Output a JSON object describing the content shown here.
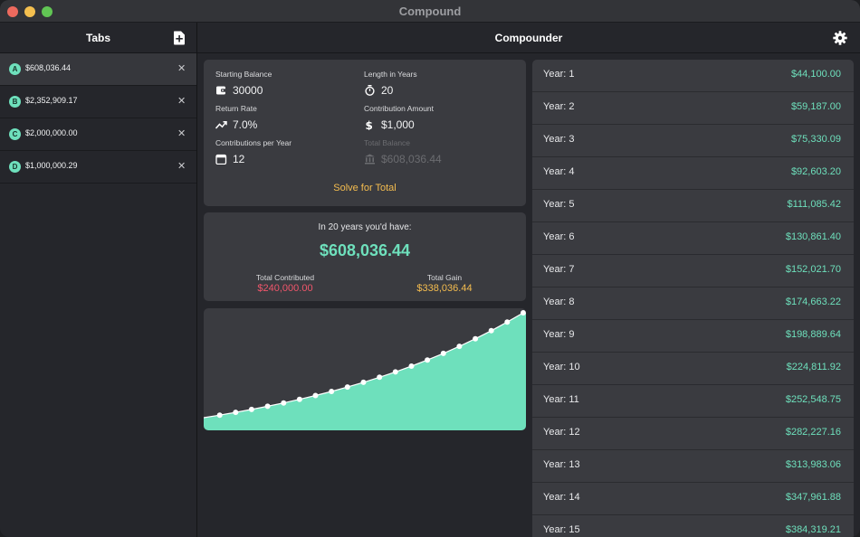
{
  "app": {
    "title": "Compound"
  },
  "sidebar": {
    "title": "Tabs",
    "tabs": [
      {
        "badge": "A",
        "label": "$608,036.44",
        "active": true
      },
      {
        "badge": "B",
        "label": "$2,352,909.17",
        "active": false
      },
      {
        "badge": "C",
        "label": "$2,000,000.00",
        "active": false
      },
      {
        "badge": "D",
        "label": "$1,000,000.29",
        "active": false
      }
    ],
    "close_glyph": "✕"
  },
  "main": {
    "title": "Compounder"
  },
  "inputs": {
    "starting_balance": {
      "label": "Starting Balance",
      "value": "30000",
      "icon": "wallet-icon"
    },
    "length_in_years": {
      "label": "Length in Years",
      "value": "20",
      "icon": "stopwatch-icon"
    },
    "return_rate": {
      "label": "Return Rate",
      "value": "7.0%",
      "icon": "trend-icon"
    },
    "contribution_amount": {
      "label": "Contribution Amount",
      "value": "$1,000",
      "icon": "dollar-icon"
    },
    "contributions_per_year": {
      "label": "Contributions per Year",
      "value": "12",
      "icon": "calendar-icon"
    },
    "total_balance": {
      "label": "Total Balance",
      "value": "$608,036.44",
      "icon": "bank-icon"
    },
    "solve_label": "Solve for Total"
  },
  "result": {
    "caption": "In 20 years you'd have:",
    "total": "$608,036.44",
    "contributed_label": "Total Contributed",
    "contributed_value": "$240,000.00",
    "gain_label": "Total Gain",
    "gain_value": "$338,036.44"
  },
  "colors": {
    "accent_green": "#6ee0bc",
    "accent_red": "#f0566b",
    "accent_orange": "#f5bd4f",
    "card_bg": "#3a3b40",
    "window_bg": "#25262b"
  },
  "chart_data": {
    "type": "area",
    "x": [
      0,
      1,
      2,
      3,
      4,
      5,
      6,
      7,
      8,
      9,
      10,
      11,
      12,
      13,
      14,
      15,
      16,
      17,
      18,
      19,
      20
    ],
    "values": [
      30000,
      44100,
      59187,
      75330.09,
      92603.2,
      111085.42,
      130861.4,
      152021.7,
      174663.22,
      198889.64,
      224811.92,
      252548.75,
      282227.16,
      313983.06,
      347961.88,
      384319.21,
      423221.56,
      464846.99,
      509385.98,
      557042.24,
      608036.44
    ],
    "title": "",
    "xlabel": "",
    "ylabel": "",
    "grid": false,
    "legend": "none"
  },
  "years": [
    {
      "label": "Year: 1",
      "value": "$44,100.00"
    },
    {
      "label": "Year: 2",
      "value": "$59,187.00"
    },
    {
      "label": "Year: 3",
      "value": "$75,330.09"
    },
    {
      "label": "Year: 4",
      "value": "$92,603.20"
    },
    {
      "label": "Year: 5",
      "value": "$111,085.42"
    },
    {
      "label": "Year: 6",
      "value": "$130,861.40"
    },
    {
      "label": "Year: 7",
      "value": "$152,021.70"
    },
    {
      "label": "Year: 8",
      "value": "$174,663.22"
    },
    {
      "label": "Year: 9",
      "value": "$198,889.64"
    },
    {
      "label": "Year: 10",
      "value": "$224,811.92"
    },
    {
      "label": "Year: 11",
      "value": "$252,548.75"
    },
    {
      "label": "Year: 12",
      "value": "$282,227.16"
    },
    {
      "label": "Year: 13",
      "value": "$313,983.06"
    },
    {
      "label": "Year: 14",
      "value": "$347,961.88"
    },
    {
      "label": "Year: 15",
      "value": "$384,319.21"
    }
  ]
}
